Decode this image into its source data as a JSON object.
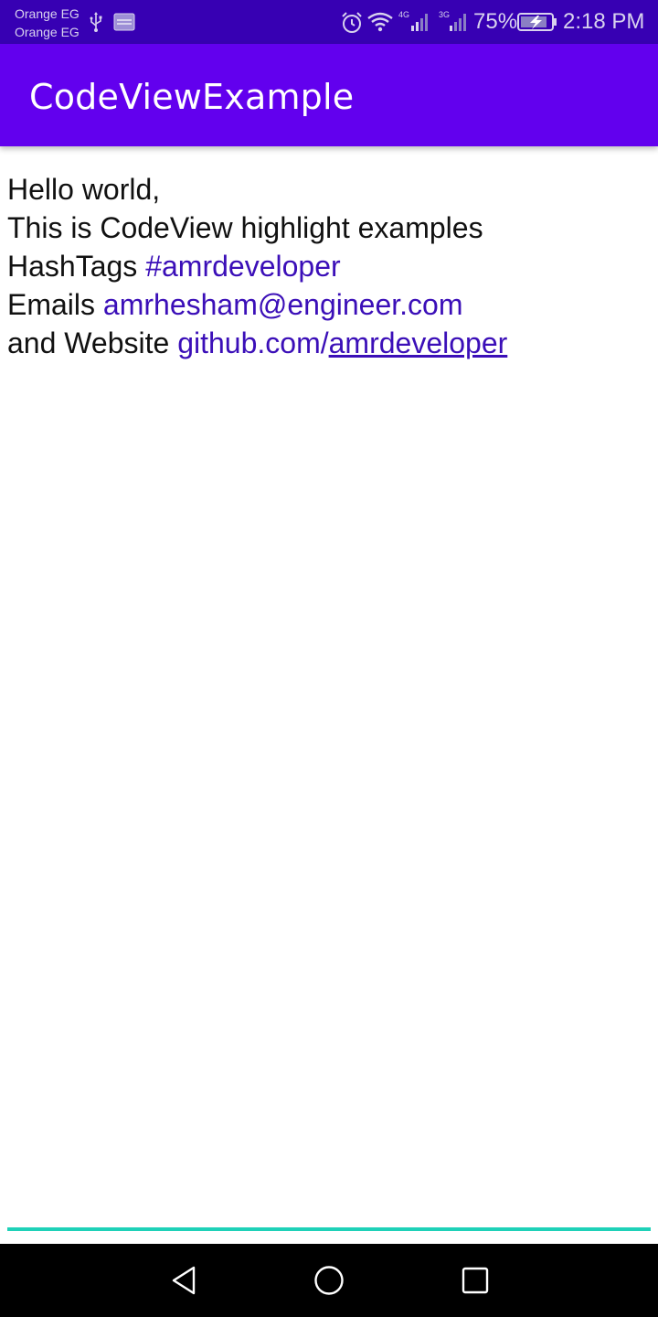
{
  "status_bar": {
    "carrier_1": "Orange EG",
    "carrier_2": "Orange EG",
    "network_1": "4G",
    "network_2": "3G",
    "battery_percent": "75%",
    "time": "2:18 PM",
    "icons": [
      "usb-icon",
      "sim-card-icon",
      "alarm-icon",
      "wifi-icon",
      "signal-icon",
      "signal-icon",
      "battery-charging-icon"
    ]
  },
  "app_bar": {
    "title": "CodeViewExample",
    "color": "#6200ee"
  },
  "content": {
    "line1": "Hello world,",
    "line2": "This is CodeView highlight examples",
    "line3_prefix": "HashTags ",
    "hashtag": "#amrdeveloper",
    "line4_prefix": "Emails ",
    "email": "amrhesham@engineer.com",
    "line5_prefix": "and Website ",
    "website_domain": "github.com/",
    "website_path": "amrdeveloper",
    "highlight_color": "#3b0fb8"
  },
  "nav_bar": {
    "icons": [
      "back-icon",
      "home-icon",
      "recents-icon"
    ]
  }
}
